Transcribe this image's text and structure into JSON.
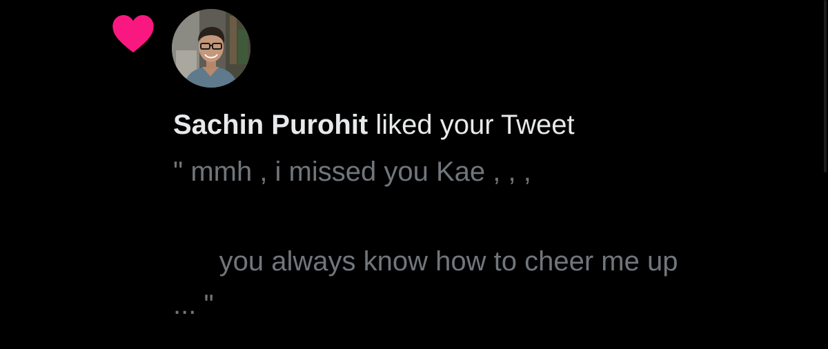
{
  "notification": {
    "type_icon": "heart-icon",
    "icon_color": "#f91880",
    "avatar": "user-avatar-photo",
    "user_name": "Sachin Purohit",
    "action_text": " liked your Tweet",
    "tweet_lines": [
      "\" mmh , i missed you Kae , , ,",
      "      you always know how to cheer me up",
      "... \""
    ]
  },
  "colors": {
    "background": "#000000",
    "primary_text": "#e7e9ea",
    "secondary_text": "#71767b",
    "like_pink": "#f91880"
  }
}
